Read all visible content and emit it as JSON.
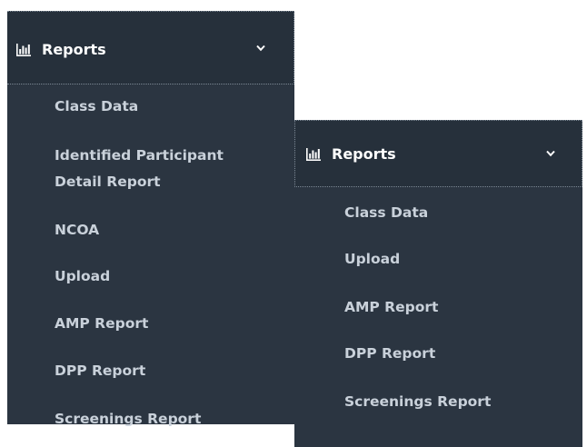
{
  "left_menu": {
    "header": {
      "label": "Reports",
      "icon": "bar-chart-icon",
      "chevron": "chevron-down-icon"
    },
    "items": [
      "Class Data",
      "Identified Participant",
      "Detail Report",
      "NCOA",
      "Upload",
      "AMP Report",
      "DPP Report",
      "Screenings Report"
    ]
  },
  "right_menu": {
    "header": {
      "label": "Reports",
      "icon": "bar-chart-icon",
      "chevron": "chevron-down-icon"
    },
    "items": [
      "Class Data",
      "Upload",
      "AMP Report",
      "DPP Report",
      "Screenings Report"
    ]
  },
  "colors": {
    "panel_bg": "#2b3541",
    "header_bg": "#26303b",
    "text": "#c9d1da",
    "header_text": "#ffffff"
  }
}
